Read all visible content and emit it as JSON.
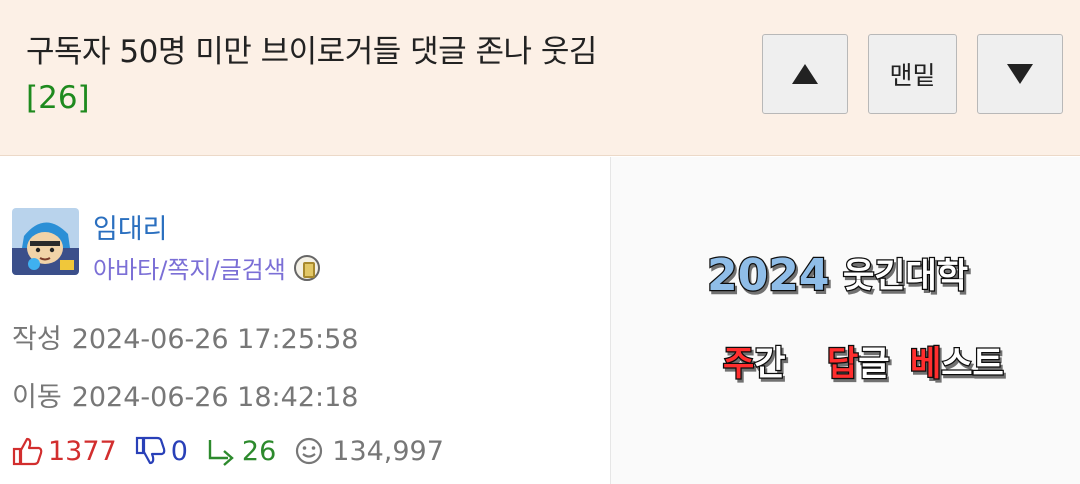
{
  "header": {
    "title": "구독자 50명 미만 브이로거들 댓글 존나 웃김",
    "comment_count": "[26]",
    "btn_up_icon": "triangle-up-icon",
    "btn_bottom_label": "맨밑",
    "btn_down_icon": "triangle-down-icon"
  },
  "author": {
    "name": "임대리",
    "links": "아바타/쪽지/글검색",
    "level_badge_icon": "level-badge-icon"
  },
  "meta": {
    "created_label": "작성",
    "created_value": "2024-06-26 17:25:58",
    "moved_label": "이동",
    "moved_value": "2024-06-26 18:42:18"
  },
  "stats": {
    "upvotes": "1377",
    "downvotes": "0",
    "replies": "26",
    "views": "134,997"
  },
  "promo": {
    "year": "2024",
    "line1": "웃긴대학",
    "w1_hl": "주",
    "w1_rest": "간",
    "w2_hl": "답",
    "w2_rest": "글",
    "w3_hl": "베",
    "w3_rest": "스트"
  },
  "colors": {
    "header_bg": "#fcf0e6",
    "count_green": "#1e8a1e",
    "username_blue": "#2a6fbf",
    "links_purple": "#7b6fd6",
    "upvote_red": "#d22e2e",
    "downvote_blue": "#2940b8",
    "reply_green": "#2d8a2d"
  }
}
